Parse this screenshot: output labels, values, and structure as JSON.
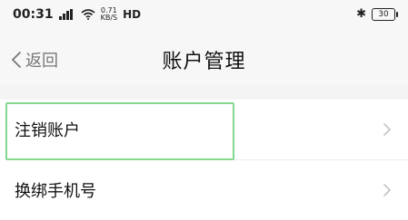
{
  "status_bar": {
    "time": "00:31",
    "net_speed_value": "0.71",
    "net_speed_unit": "KB/S",
    "hd": "HD",
    "battery": "30"
  },
  "nav": {
    "back_label": "返回",
    "title": "账户管理"
  },
  "list": {
    "items": [
      {
        "label": "注销账户"
      },
      {
        "label": "换绑手机号"
      }
    ]
  },
  "colors": {
    "highlight": "#86d78f",
    "nav_bg": "#f7f7f7",
    "chevron": "#c4c4c4"
  }
}
